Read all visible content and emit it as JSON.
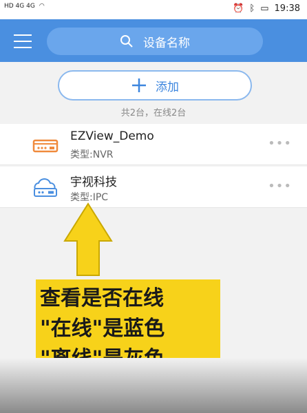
{
  "status": {
    "left": "HD 4G 4G",
    "time": "19:38"
  },
  "header": {
    "search_placeholder": "设备名称"
  },
  "add_label": "添加",
  "summary": "共2台，在线2台",
  "devices": [
    {
      "name": "EZView_Demo",
      "type": "类型:NVR",
      "icon": "nvr-icon",
      "color": "#f08a3c"
    },
    {
      "name": "宇视科技",
      "type": "类型:IPC",
      "icon": "ipc-cloud-icon",
      "color": "#4a8fe0"
    }
  ],
  "annotation": {
    "line1": "查看是否在线",
    "line2": "\"在线\"是蓝色",
    "line3": "\"离线\"是灰色"
  },
  "colors": {
    "header": "#4a8fe0",
    "arrow": "#f7d21a"
  }
}
